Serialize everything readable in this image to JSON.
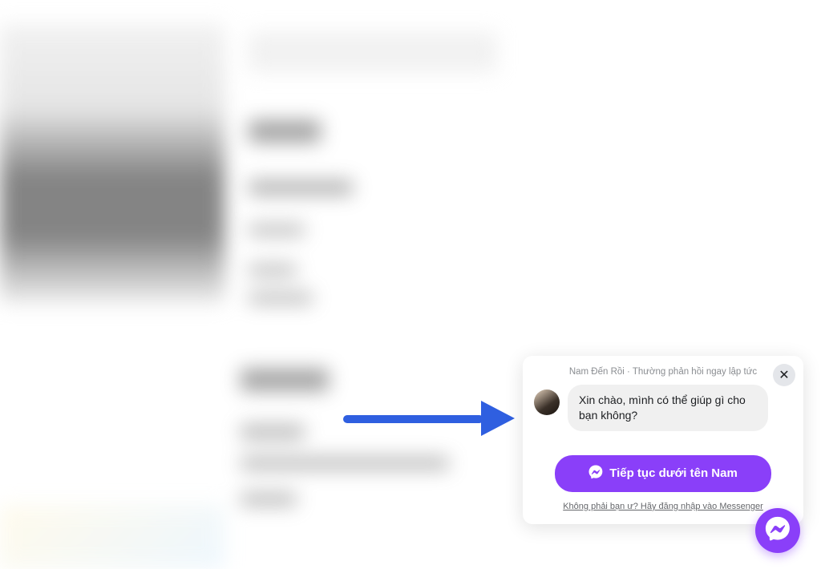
{
  "chat": {
    "header_name": "Nam Đến Rồi",
    "header_status": "Thường phản hồi ngay lập tức",
    "greeting_message": "Xin chào, mình có thể giúp gì cho bạn không?",
    "continue_button_label": "Tiếp tục dưới tên Nam",
    "footer_link_text": "Không phải bạn ư? Hãy đăng nhập vào Messenger",
    "close_label": "✕"
  },
  "colors": {
    "accent": "#8a3ff9",
    "arrow": "#2f5fe0"
  }
}
